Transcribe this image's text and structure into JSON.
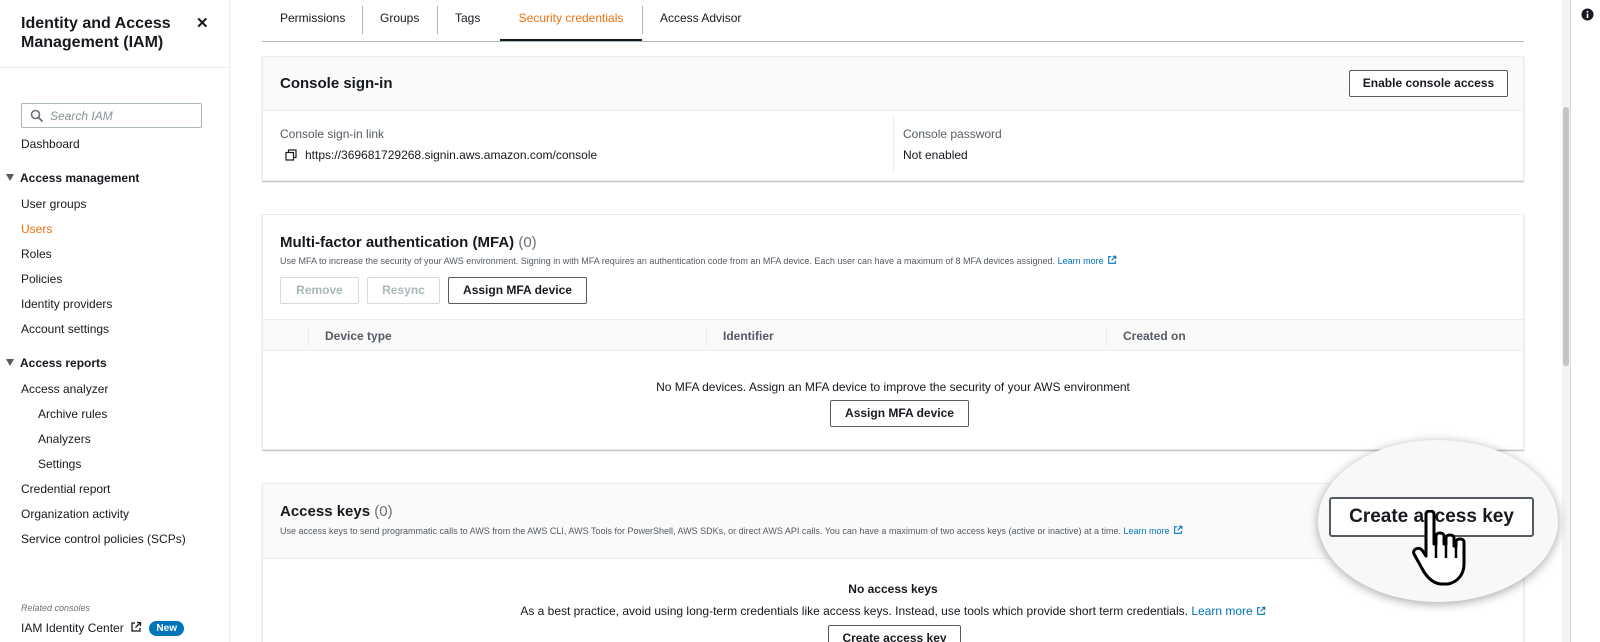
{
  "sidebar": {
    "title": "Identity and Access Management (IAM)",
    "search_placeholder": "Search IAM",
    "dashboard": "Dashboard",
    "access_management": {
      "label": "Access management",
      "items": [
        "User groups",
        "Users",
        "Roles",
        "Policies",
        "Identity providers",
        "Account settings"
      ],
      "active": "Users"
    },
    "access_reports": {
      "label": "Access reports",
      "analyzer": "Access analyzer",
      "analyzer_items": [
        "Archive rules",
        "Analyzers",
        "Settings"
      ],
      "items": [
        "Credential report",
        "Organization activity",
        "Service control policies (SCPs)"
      ]
    },
    "related_consoles_label": "Related consoles",
    "identity_center": "IAM Identity Center",
    "new_badge": "New"
  },
  "tabs": [
    "Permissions",
    "Groups",
    "Tags",
    "Security credentials",
    "Access Advisor"
  ],
  "active_tab": "Security credentials",
  "console_signin": {
    "title": "Console sign-in",
    "enable_button": "Enable console access",
    "link_label": "Console sign-in link",
    "link_value": "https://369681729268.signin.aws.amazon.com/console",
    "password_label": "Console password",
    "password_value": "Not enabled"
  },
  "mfa": {
    "title": "Multi-factor authentication (MFA)",
    "count": "(0)",
    "description": "Use MFA to increase the security of your AWS environment. Signing in with MFA requires an authentication code from an MFA device. Each user can have a maximum of 8 MFA devices assigned.",
    "learn_more": "Learn more",
    "remove_button": "Remove",
    "resync_button": "Resync",
    "assign_button": "Assign MFA device",
    "columns": [
      "Device type",
      "Identifier",
      "Created on"
    ],
    "empty_text": "No MFA devices. Assign an MFA device to improve the security of your AWS environment",
    "empty_assign_button": "Assign MFA device"
  },
  "access_keys": {
    "title": "Access keys",
    "count": "(0)",
    "description": "Use access keys to send programmatic calls to AWS from the AWS CLI, AWS Tools for PowerShell, AWS SDKs, or direct AWS API calls. You can have a maximum of two access keys (active or inactive) at a time.",
    "learn_more": "Learn more",
    "create_button": "Create access key",
    "empty_title": "No access keys",
    "empty_text": "As a best practice, avoid using long-term credentials like access keys. Instead, use tools which provide short term credentials.",
    "empty_learn_more": "Learn more",
    "empty_create_button": "Create access key"
  },
  "colors": {
    "accent": "#ec7211",
    "link": "#0073bb",
    "text": "#16191f",
    "muted": "#545b64"
  }
}
